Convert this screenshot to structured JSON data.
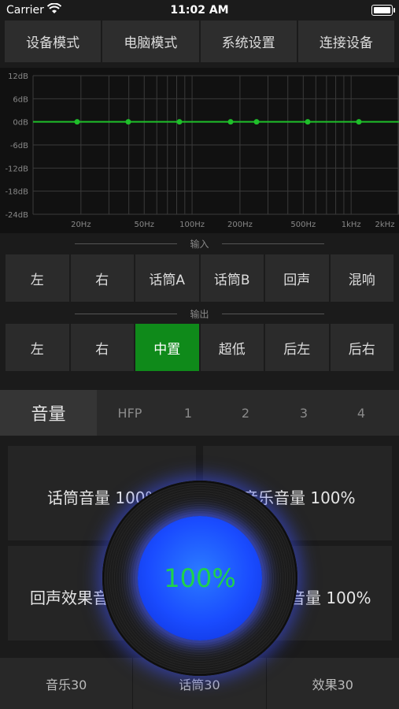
{
  "status_bar": {
    "carrier": "Carrier",
    "time": "11:02 AM"
  },
  "top_nav": [
    "设备模式",
    "电脑模式",
    "系统设置",
    "连接设备"
  ],
  "eq": {
    "y_labels": [
      "12dB",
      "6dB",
      "0dB",
      "-6dB",
      "-12dB",
      "-18dB",
      "-24dB"
    ],
    "x_labels": [
      "20Hz",
      "50Hz",
      "100Hz",
      "200Hz",
      "500Hz",
      "1kHz",
      "2kHz"
    ],
    "line_color": "#1fbf2a",
    "points_db": [
      0,
      0,
      0,
      0,
      0,
      0,
      0
    ]
  },
  "input_section": {
    "label": "输入",
    "buttons": [
      "左",
      "右",
      "话筒A",
      "话筒B",
      "回声",
      "混响"
    ]
  },
  "output_section": {
    "label": "输出",
    "buttons": [
      "左",
      "右",
      "中置",
      "超低",
      "后左",
      "后右"
    ],
    "active_index": 2
  },
  "tabs": {
    "main": "音量",
    "items": [
      "HFP",
      "1",
      "2",
      "3",
      "4"
    ]
  },
  "cards": {
    "mic_volume": "话筒音量 100%",
    "music_volume": "音乐音量 100%",
    "echo_volume": "回声效果音量 100%",
    "effect_volume": "音量 100%"
  },
  "knob": {
    "value": "100%",
    "accent": "#1a4cff"
  },
  "bottom_bar": [
    "音乐30",
    "话筒30",
    "效果30"
  ],
  "colors": {
    "active_green": "#0f8a1a",
    "value_green": "#1fd24a"
  }
}
